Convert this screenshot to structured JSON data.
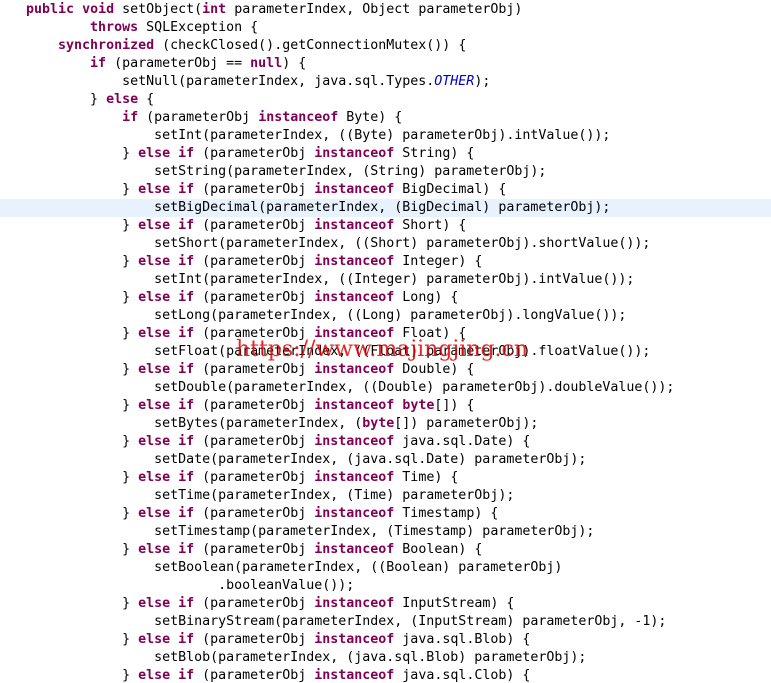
{
  "editor": {
    "lines": [
      [
        [
          "kw",
          "public"
        ],
        [
          "t",
          " "
        ],
        [
          "kw",
          "void"
        ],
        [
          "t",
          " setObject("
        ],
        [
          "kw",
          "int"
        ],
        [
          "t",
          " parameterIndex, Object parameterObj)"
        ]
      ],
      [
        [
          "t",
          "        "
        ],
        [
          "kw",
          "throws"
        ],
        [
          "t",
          " SQLException {"
        ]
      ],
      [
        [
          "t",
          "    "
        ],
        [
          "kw",
          "synchronized"
        ],
        [
          "t",
          " (checkClosed().getConnectionMutex()) {"
        ]
      ],
      [
        [
          "t",
          "        "
        ],
        [
          "kw",
          "if"
        ],
        [
          "t",
          " (parameterObj == "
        ],
        [
          "kw",
          "null"
        ],
        [
          "t",
          ") {"
        ]
      ],
      [
        [
          "t",
          "            setNull(parameterIndex, java.sql.Types."
        ],
        [
          "con",
          "OTHER"
        ],
        [
          "t",
          ");"
        ]
      ],
      [
        [
          "t",
          "        } "
        ],
        [
          "kw",
          "else"
        ],
        [
          "t",
          " {"
        ]
      ],
      [
        [
          "t",
          "            "
        ],
        [
          "kw",
          "if"
        ],
        [
          "t",
          " (parameterObj "
        ],
        [
          "kw",
          "instanceof"
        ],
        [
          "t",
          " Byte) {"
        ]
      ],
      [
        [
          "t",
          "                setInt(parameterIndex, ((Byte) parameterObj).intValue());"
        ]
      ],
      [
        [
          "t",
          "            } "
        ],
        [
          "kw",
          "else"
        ],
        [
          "t",
          " "
        ],
        [
          "kw",
          "if"
        ],
        [
          "t",
          " (parameterObj "
        ],
        [
          "kw",
          "instanceof"
        ],
        [
          "t",
          " String) {"
        ]
      ],
      [
        [
          "t",
          "                setString(parameterIndex, (String) parameterObj);"
        ]
      ],
      [
        [
          "t",
          "            } "
        ],
        [
          "kw",
          "else"
        ],
        [
          "t",
          " "
        ],
        [
          "kw",
          "if"
        ],
        [
          "t",
          " (parameterObj "
        ],
        [
          "kw",
          "instanceof"
        ],
        [
          "t",
          " BigDecimal) {"
        ]
      ],
      [
        [
          "t",
          "                setBigDecimal(parameterIndex, (BigDecimal) parameterObj);"
        ]
      ],
      [
        [
          "t",
          "            } "
        ],
        [
          "kw",
          "else"
        ],
        [
          "t",
          " "
        ],
        [
          "kw",
          "if"
        ],
        [
          "t",
          " (parameterObj "
        ],
        [
          "kw",
          "instanceof"
        ],
        [
          "t",
          " Short) {"
        ]
      ],
      [
        [
          "t",
          "                setShort(parameterIndex, ((Short) parameterObj).shortValue());"
        ]
      ],
      [
        [
          "t",
          "            } "
        ],
        [
          "kw",
          "else"
        ],
        [
          "t",
          " "
        ],
        [
          "kw",
          "if"
        ],
        [
          "t",
          " (parameterObj "
        ],
        [
          "kw",
          "instanceof"
        ],
        [
          "t",
          " Integer) {"
        ]
      ],
      [
        [
          "t",
          "                setInt(parameterIndex, ((Integer) parameterObj).intValue());"
        ]
      ],
      [
        [
          "t",
          "            } "
        ],
        [
          "kw",
          "else"
        ],
        [
          "t",
          " "
        ],
        [
          "kw",
          "if"
        ],
        [
          "t",
          " (parameterObj "
        ],
        [
          "kw",
          "instanceof"
        ],
        [
          "t",
          " Long) {"
        ]
      ],
      [
        [
          "t",
          "                setLong(parameterIndex, ((Long) parameterObj).longValue());"
        ]
      ],
      [
        [
          "t",
          "            } "
        ],
        [
          "kw",
          "else"
        ],
        [
          "t",
          " "
        ],
        [
          "kw",
          "if"
        ],
        [
          "t",
          " (parameterObj "
        ],
        [
          "kw",
          "instanceof"
        ],
        [
          "t",
          " Float) {"
        ]
      ],
      [
        [
          "t",
          "                setFloat(parameterIndex, ((Float) parameterObj).floatValue());"
        ]
      ],
      [
        [
          "t",
          "            } "
        ],
        [
          "kw",
          "else"
        ],
        [
          "t",
          " "
        ],
        [
          "kw",
          "if"
        ],
        [
          "t",
          " (parameterObj "
        ],
        [
          "kw",
          "instanceof"
        ],
        [
          "t",
          " Double) {"
        ]
      ],
      [
        [
          "t",
          "                setDouble(parameterIndex, ((Double) parameterObj).doubleValue());"
        ]
      ],
      [
        [
          "t",
          "            } "
        ],
        [
          "kw",
          "else"
        ],
        [
          "t",
          " "
        ],
        [
          "kw",
          "if"
        ],
        [
          "t",
          " (parameterObj "
        ],
        [
          "kw",
          "instanceof"
        ],
        [
          "t",
          " "
        ],
        [
          "kw",
          "byte"
        ],
        [
          "t",
          "[]) {"
        ]
      ],
      [
        [
          "t",
          "                setBytes(parameterIndex, ("
        ],
        [
          "kw",
          "byte"
        ],
        [
          "t",
          "[]) parameterObj);"
        ]
      ],
      [
        [
          "t",
          "            } "
        ],
        [
          "kw",
          "else"
        ],
        [
          "t",
          " "
        ],
        [
          "kw",
          "if"
        ],
        [
          "t",
          " (parameterObj "
        ],
        [
          "kw",
          "instanceof"
        ],
        [
          "t",
          " java.sql.Date) {"
        ]
      ],
      [
        [
          "t",
          "                setDate(parameterIndex, (java.sql.Date) parameterObj);"
        ]
      ],
      [
        [
          "t",
          "            } "
        ],
        [
          "kw",
          "else"
        ],
        [
          "t",
          " "
        ],
        [
          "kw",
          "if"
        ],
        [
          "t",
          " (parameterObj "
        ],
        [
          "kw",
          "instanceof"
        ],
        [
          "t",
          " Time) {"
        ]
      ],
      [
        [
          "t",
          "                setTime(parameterIndex, (Time) parameterObj);"
        ]
      ],
      [
        [
          "t",
          "            } "
        ],
        [
          "kw",
          "else"
        ],
        [
          "t",
          " "
        ],
        [
          "kw",
          "if"
        ],
        [
          "t",
          " (parameterObj "
        ],
        [
          "kw",
          "instanceof"
        ],
        [
          "t",
          " Timestamp) {"
        ]
      ],
      [
        [
          "t",
          "                setTimestamp(parameterIndex, (Timestamp) parameterObj);"
        ]
      ],
      [
        [
          "t",
          "            } "
        ],
        [
          "kw",
          "else"
        ],
        [
          "t",
          " "
        ],
        [
          "kw",
          "if"
        ],
        [
          "t",
          " (parameterObj "
        ],
        [
          "kw",
          "instanceof"
        ],
        [
          "t",
          " Boolean) {"
        ]
      ],
      [
        [
          "t",
          "                setBoolean(parameterIndex, ((Boolean) parameterObj)"
        ]
      ],
      [
        [
          "t",
          "                        .booleanValue());"
        ]
      ],
      [
        [
          "t",
          "            } "
        ],
        [
          "kw",
          "else"
        ],
        [
          "t",
          " "
        ],
        [
          "kw",
          "if"
        ],
        [
          "t",
          " (parameterObj "
        ],
        [
          "kw",
          "instanceof"
        ],
        [
          "t",
          " InputStream) {"
        ]
      ],
      [
        [
          "t",
          "                setBinaryStream(parameterIndex, (InputStream) parameterObj, -1);"
        ]
      ],
      [
        [
          "t",
          "            } "
        ],
        [
          "kw",
          "else"
        ],
        [
          "t",
          " "
        ],
        [
          "kw",
          "if"
        ],
        [
          "t",
          " (parameterObj "
        ],
        [
          "kw",
          "instanceof"
        ],
        [
          "t",
          " java.sql.Blob) {"
        ]
      ],
      [
        [
          "t",
          "                setBlob(parameterIndex, (java.sql.Blob) parameterObj);"
        ]
      ],
      [
        [
          "t",
          "            } "
        ],
        [
          "kw",
          "else"
        ],
        [
          "t",
          " "
        ],
        [
          "kw",
          "if"
        ],
        [
          "t",
          " (parameterObj "
        ],
        [
          "kw",
          "instanceof"
        ],
        [
          "t",
          " java.sql.Clob) {"
        ]
      ]
    ],
    "current_line": 11,
    "colors": {
      "keyword": "#7f0055",
      "constant": "#0000c0",
      "text": "#000000",
      "current_line_bg": "#e8f2fe",
      "watermark": "#e60000"
    }
  },
  "watermark": {
    "text": "https://www.majingjing.cn"
  }
}
